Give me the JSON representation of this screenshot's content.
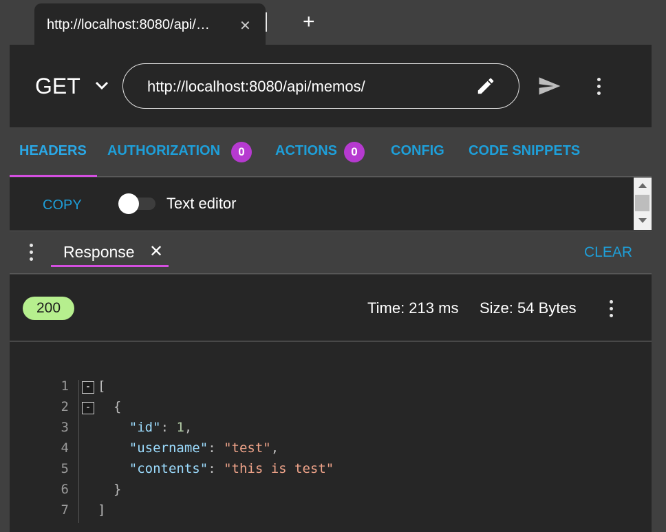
{
  "browser_tab": {
    "title": "http://localhost:8080/api/…",
    "close_glyph": "✕",
    "new_tab_glyph": "+"
  },
  "request": {
    "method": "GET",
    "url": "http://localhost:8080/api/memos/"
  },
  "request_tabs": [
    {
      "label": "HEADERS",
      "active": true
    },
    {
      "label": "AUTHORIZATION",
      "badge": "0"
    },
    {
      "label": "ACTIONS",
      "badge": "0"
    },
    {
      "label": "CONFIG"
    },
    {
      "label": "CODE SNIPPETS"
    }
  ],
  "headers_panel": {
    "copy_label": "COPY",
    "text_editor_label": "Text editor",
    "text_editor_on": false
  },
  "response_panel": {
    "tab_label": "Response",
    "close_glyph": "✕",
    "clear_label": "CLEAR"
  },
  "status": {
    "code": "200",
    "time": "Time: 213 ms",
    "size": "Size: 54 Bytes"
  },
  "response_body": {
    "line_numbers": [
      "1",
      "2",
      "3",
      "4",
      "5",
      "6",
      "7"
    ],
    "lines": [
      {
        "indent": "",
        "parts": [
          {
            "t": "[",
            "c": "punct"
          }
        ],
        "fold": "-"
      },
      {
        "indent": "  ",
        "parts": [
          {
            "t": "{",
            "c": "punct"
          }
        ],
        "fold": "-"
      },
      {
        "indent": "    ",
        "parts": [
          {
            "t": "\"id\"",
            "c": "key"
          },
          {
            "t": ": ",
            "c": "punct"
          },
          {
            "t": "1",
            "c": "num"
          },
          {
            "t": ",",
            "c": "punct"
          }
        ]
      },
      {
        "indent": "    ",
        "parts": [
          {
            "t": "\"username\"",
            "c": "key"
          },
          {
            "t": ": ",
            "c": "punct"
          },
          {
            "t": "\"test\"",
            "c": "str"
          },
          {
            "t": ",",
            "c": "punct"
          }
        ]
      },
      {
        "indent": "    ",
        "parts": [
          {
            "t": "\"contents\"",
            "c": "key"
          },
          {
            "t": ": ",
            "c": "punct"
          },
          {
            "t": "\"this is test\"",
            "c": "str"
          }
        ]
      },
      {
        "indent": "  ",
        "parts": [
          {
            "t": "}",
            "c": "punct"
          }
        ]
      },
      {
        "indent": "",
        "parts": [
          {
            "t": "]",
            "c": "punct"
          }
        ]
      }
    ]
  },
  "colors": {
    "accent": "#1e9fd9",
    "underline": "#d44fe0",
    "badge": "#b63ad0",
    "status_ok": "#b6ef8e"
  },
  "icons": {
    "method_dropdown": "chevron-down-icon",
    "url_edit": "pencil-icon",
    "send": "send-icon",
    "menu": "more-vert-icon"
  }
}
